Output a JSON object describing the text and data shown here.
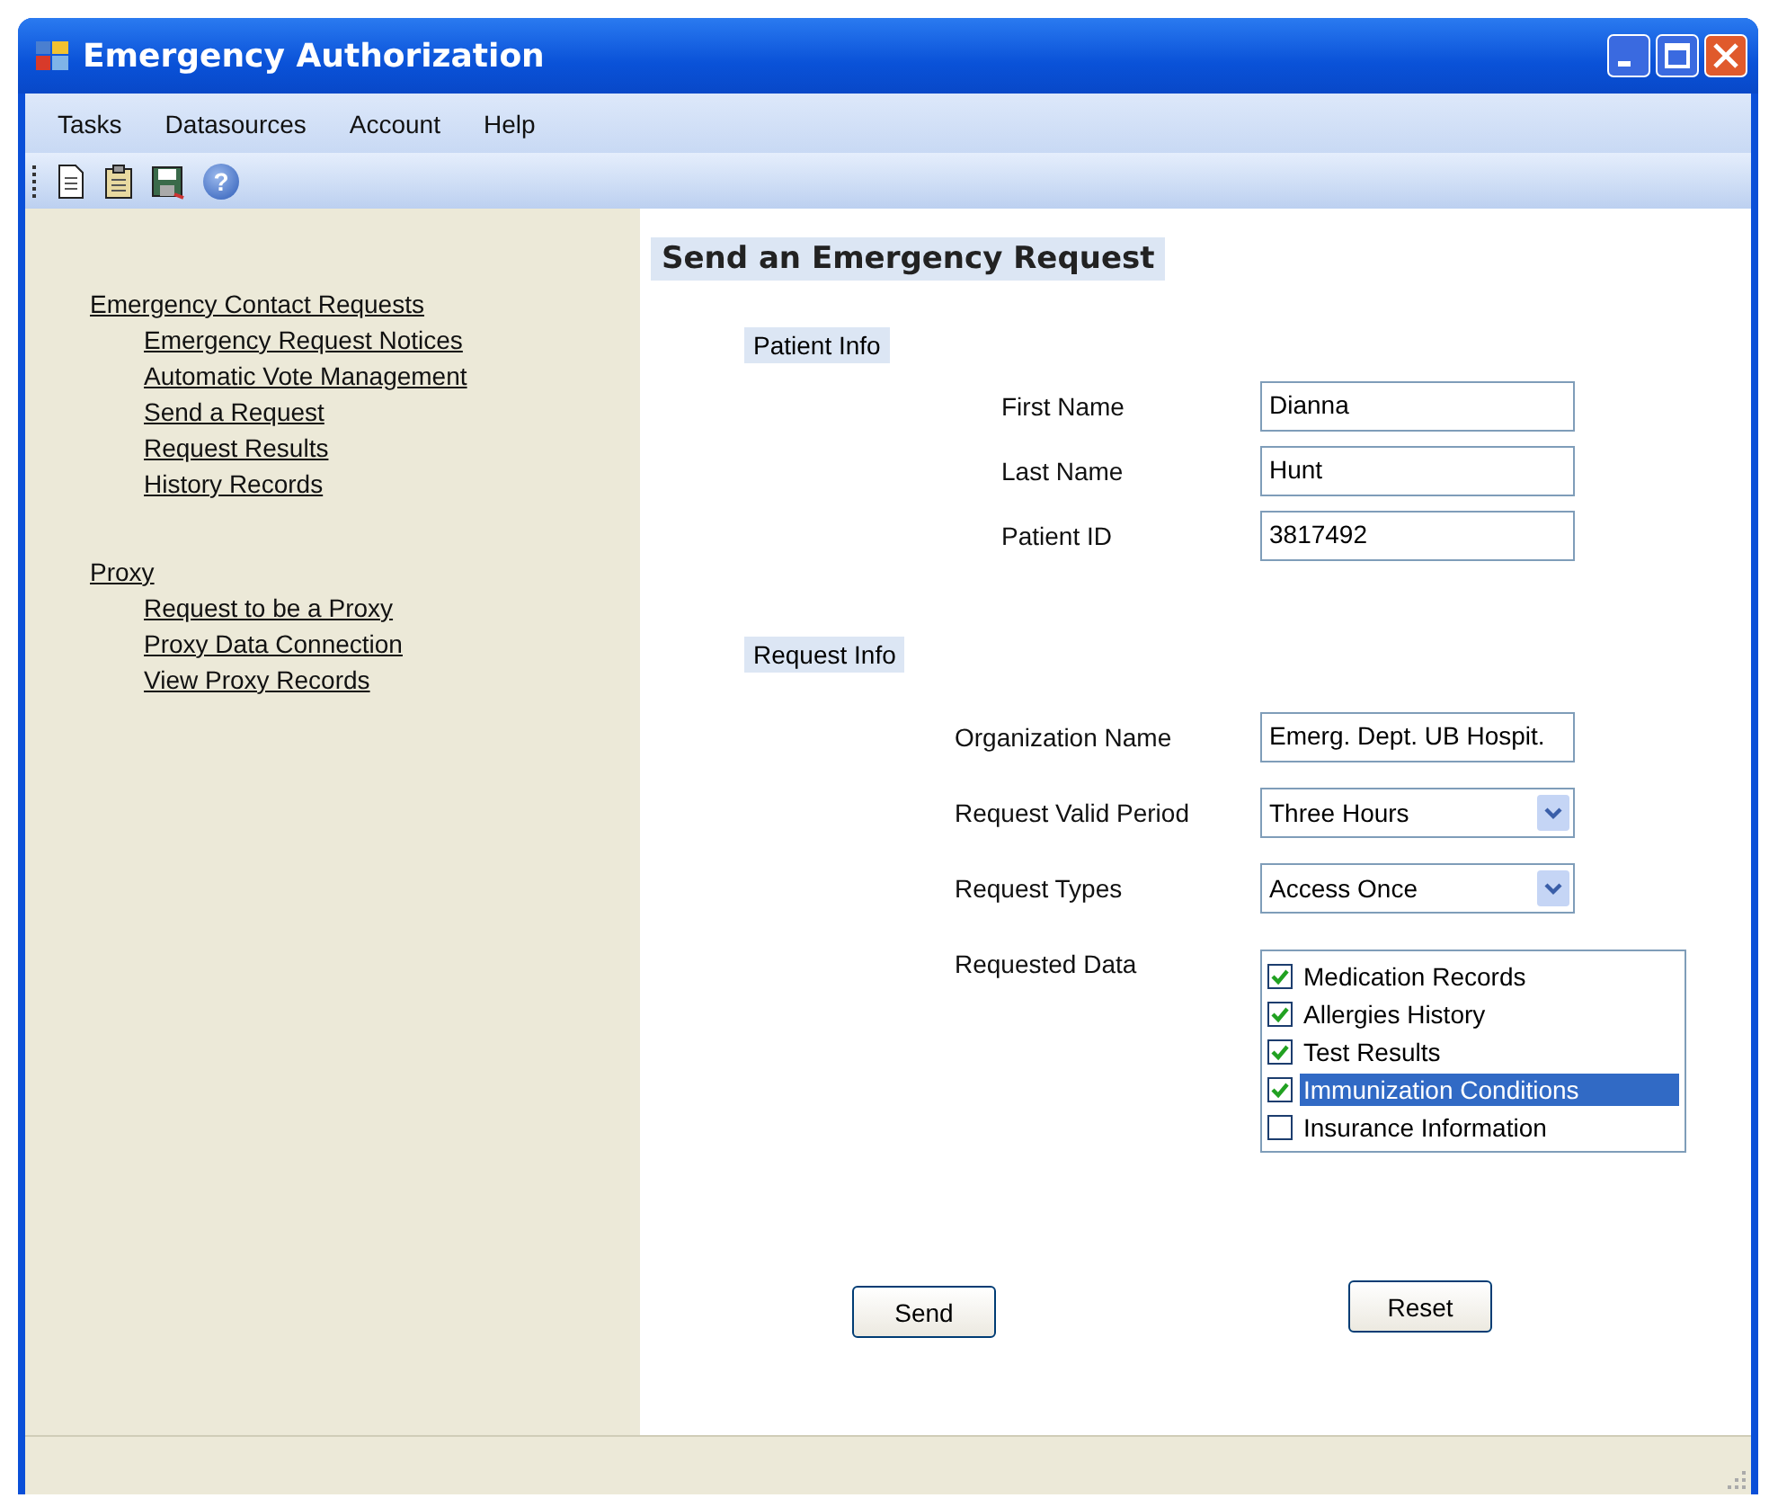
{
  "window": {
    "title": "Emergency Authorization"
  },
  "menu": [
    "Tasks",
    "Datasources",
    "Account",
    "Help"
  ],
  "toolbar": [
    {
      "kind": "new"
    },
    {
      "kind": "open"
    },
    {
      "kind": "save"
    },
    {
      "kind": "help",
      "glyph": "?"
    }
  ],
  "sidebar": {
    "groups": [
      {
        "label": "Emergency Contact Requests",
        "children": [
          {
            "label": "Emergency Request Notices"
          },
          {
            "label": "Automatic Vote Management"
          },
          {
            "label": "Send a Request"
          },
          {
            "label": "Request Results"
          },
          {
            "label": "History Records"
          }
        ]
      },
      {
        "label": "Proxy",
        "children": [
          {
            "label": "Request to be a Proxy"
          },
          {
            "label": "Proxy Data Connection"
          },
          {
            "label": "View Proxy Records"
          }
        ]
      }
    ]
  },
  "form": {
    "title": "Send an Emergency Request",
    "sections": [
      {
        "title": "Patient Info",
        "fields": [
          {
            "kind": "text",
            "label": "First Name",
            "value": "Dianna"
          },
          {
            "kind": "text",
            "label": "Last Name",
            "value": "Hunt"
          },
          {
            "kind": "text",
            "label": "Patient ID",
            "value": "3817492"
          }
        ]
      },
      {
        "title": "Request Info",
        "fields": [
          {
            "kind": "text",
            "label": "Organization Name",
            "value": "Emerg. Dept. UB Hospit."
          },
          {
            "kind": "dropdown",
            "label": "Request Valid Period",
            "value": "Three Hours"
          },
          {
            "kind": "dropdown",
            "label": "Request Types",
            "value": "Access Once"
          },
          {
            "kind": "checklist",
            "label": "Requested Data",
            "items": [
              {
                "label": "Medication Records",
                "checked": true,
                "selected": false
              },
              {
                "label": "Allergies History",
                "checked": true,
                "selected": false
              },
              {
                "label": "Test Results",
                "checked": true,
                "selected": false
              },
              {
                "label": "Immunization Conditions",
                "checked": true,
                "selected": true
              },
              {
                "label": "Insurance Information",
                "checked": false,
                "selected": false
              }
            ]
          }
        ]
      }
    ],
    "buttons": [
      "Send",
      "Reset"
    ]
  }
}
